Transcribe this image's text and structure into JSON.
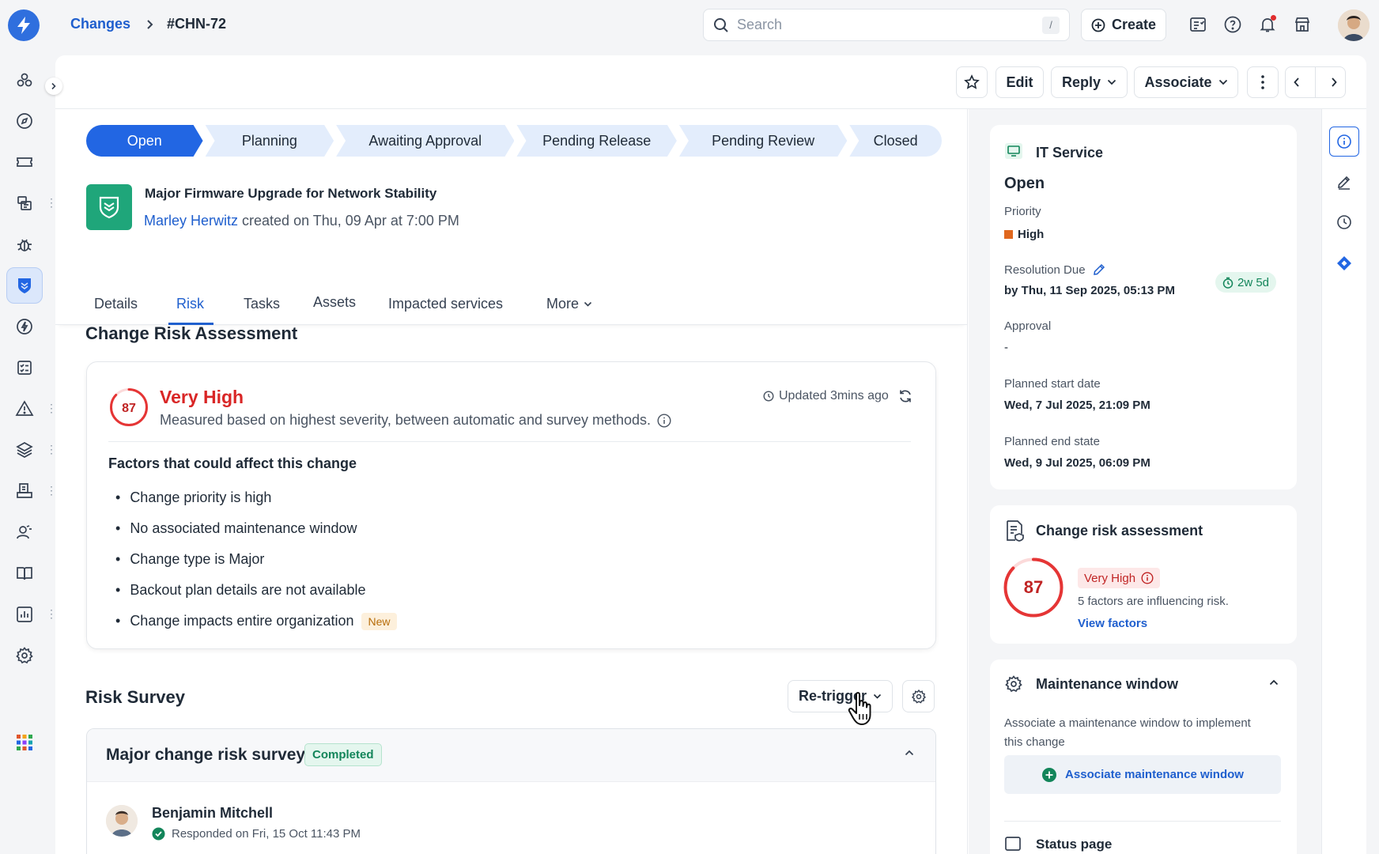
{
  "breadcrumb": {
    "parent": "Changes",
    "current": "#CHN-72"
  },
  "search": {
    "placeholder": "Search",
    "shortcut": "/"
  },
  "topbar": {
    "create_label": "Create"
  },
  "toolbar": {
    "edit_label": "Edit",
    "reply_label": "Reply",
    "associate_label": "Associate"
  },
  "stepper": [
    "Open",
    "Planning",
    "Awaiting Approval",
    "Pending Release",
    "Pending Review",
    "Closed"
  ],
  "ticket": {
    "title": "Major Firmware Upgrade for Network Stability",
    "author": "Marley Herwitz",
    "created": "created on Thu, 09 Apr at 7:00 PM"
  },
  "tabs": [
    "Details",
    "Risk",
    "Tasks",
    "Assets",
    "Impacted services",
    "More"
  ],
  "risk": {
    "section_title": "Change Risk Assessment",
    "score": "87",
    "score_fraction": 0.87,
    "level": "Very High",
    "description": "Measured based on highest severity, between automatic and survey methods.",
    "updated": "Updated 3mins ago",
    "factors_title": "Factors that could affect this change",
    "factors": [
      "Change priority is high",
      "No associated maintenance window",
      "Change type is Major",
      "Backout plan details are not available",
      "Change impacts entire organization"
    ],
    "new_badge": "New"
  },
  "survey": {
    "section_title": "Risk Survey",
    "retrigger_label": "Re-trigger",
    "name": "Major change risk survey",
    "status": "Completed",
    "responder": "Benjamin Mitchell",
    "responded": "Responded on Fri, 15 Oct 11:43 PM"
  },
  "properties": {
    "service": "IT Service",
    "status": "Open",
    "priority_label": "Priority",
    "priority": "High",
    "priority_color": "#e0671e",
    "resolution_label": "Resolution Due",
    "resolution": "by Thu, 11 Sep 2025, 05:13 PM",
    "sla": "2w 5d",
    "approval_label": "Approval",
    "approval": "-",
    "start_label": "Planned start date",
    "start": "Wed, 7 Jul 2025, 21:09 PM",
    "end_label": "Planned end state",
    "end": "Wed, 9 Jul 2025, 06:09 PM"
  },
  "risk_panel": {
    "title": "Change risk assessment",
    "score": "87",
    "level": "Very High",
    "summary": "5 factors are influencing risk.",
    "link": "View factors"
  },
  "maintenance": {
    "title": "Maintenance window",
    "description_line1": "Associate a maintenance window to implement",
    "description_line2": "this change",
    "button": "Associate maintenance window",
    "next_section": "Status page"
  },
  "colors": {
    "accent": "#2266e3",
    "risk": "#e53535",
    "success": "#13855a"
  }
}
